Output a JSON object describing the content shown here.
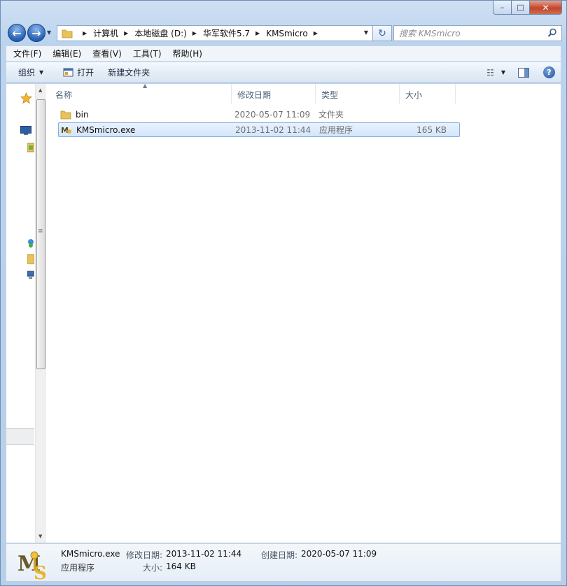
{
  "window": {
    "caption_buttons": {
      "minimize": "–",
      "maximize": "□",
      "close": "✕"
    }
  },
  "address": {
    "breadcrumbs": [
      "计算机",
      "本地磁盘 (D:)",
      "华军软件5.7",
      "KMSmicro"
    ],
    "search_placeholder": "搜索 KMSmicro"
  },
  "menu": [
    "文件(F)",
    "编辑(E)",
    "查看(V)",
    "工具(T)",
    "帮助(H)"
  ],
  "commands": {
    "organize": "组织",
    "open": "打开",
    "new_folder": "新建文件夹"
  },
  "columns": {
    "name": "名称",
    "date": "修改日期",
    "type": "类型",
    "size": "大小"
  },
  "files": [
    {
      "name": "bin",
      "date": "2020-05-07 11:09",
      "type": "文件夹",
      "size": "",
      "icon": "folder-icon",
      "selected": false
    },
    {
      "name": "KMSmicro.exe",
      "date": "2013-11-02 11:44",
      "type": "应用程序",
      "size": "165 KB",
      "icon": "kmsmicro-app-icon",
      "selected": true
    }
  ],
  "details": {
    "name": "KMSmicro.exe",
    "type": "应用程序",
    "modified_label": "修改日期:",
    "modified_value": "2013-11-02 11:44",
    "size_label": "大小:",
    "size_value": "164 KB",
    "created_label": "创建日期:",
    "created_value": "2020-05-07 11:09"
  },
  "colors": {
    "selection": "#d3e5fb",
    "selection_border": "#84acdd",
    "frame": "#bcd3ee"
  }
}
